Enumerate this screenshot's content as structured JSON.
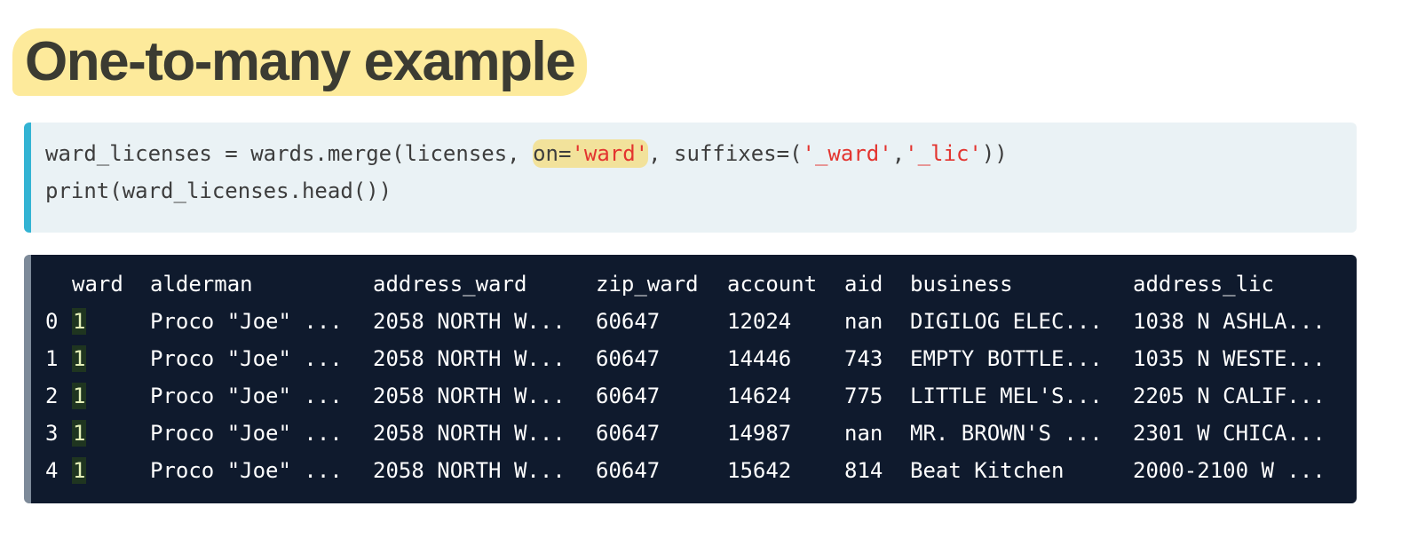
{
  "slide": {
    "title": "One-to-many example"
  },
  "code": {
    "line1": [
      {
        "text": "ward_licenses = wards.merge(licenses, ",
        "kind": "plain"
      },
      {
        "text": "on=",
        "kind": "hl-plain"
      },
      {
        "text": "'ward'",
        "kind": "hl-str"
      },
      {
        "text": ", suffixes=(",
        "kind": "plain"
      },
      {
        "text": "'_ward'",
        "kind": "str"
      },
      {
        "text": ",",
        "kind": "plain"
      },
      {
        "text": "'_lic'",
        "kind": "str"
      },
      {
        "text": "))",
        "kind": "plain"
      }
    ],
    "line2": "print(ward_licenses.head())"
  },
  "output": {
    "columns": [
      "ward",
      "alderman",
      "address_ward",
      "zip_ward",
      "account",
      "aid",
      "business",
      "address_lic"
    ],
    "rows": [
      {
        "index": "0",
        "cells": [
          "1",
          "Proco \"Joe\" ...",
          "2058 NORTH W...",
          "60647",
          "12024",
          "nan",
          "DIGILOG ELEC...",
          "1038 N ASHLA..."
        ]
      },
      {
        "index": "1",
        "cells": [
          "1",
          "Proco \"Joe\" ...",
          "2058 NORTH W...",
          "60647",
          "14446",
          "743",
          "EMPTY BOTTLE...",
          "1035 N WESTE..."
        ]
      },
      {
        "index": "2",
        "cells": [
          "1",
          "Proco \"Joe\" ...",
          "2058 NORTH W...",
          "60647",
          "14624",
          "775",
          "LITTLE MEL'S...",
          "2205 N CALIF..."
        ]
      },
      {
        "index": "3",
        "cells": [
          "1",
          "Proco \"Joe\" ...",
          "2058 NORTH W...",
          "60647",
          "14987",
          "nan",
          "MR. BROWN'S ...",
          "2301 W CHICA..."
        ]
      },
      {
        "index": "4",
        "cells": [
          "1",
          "Proco \"Joe\" ...",
          "2058 NORTH W...",
          "60647",
          "15642",
          "814",
          "Beat Kitchen",
          "2000-2100 W ..."
        ]
      }
    ]
  },
  "colors": {
    "title_highlight": "#fdea9b",
    "code_bg": "#eaf2f5",
    "code_accent": "#33b3d3",
    "string": "#e3342f",
    "output_bg": "#0f1a2d"
  }
}
